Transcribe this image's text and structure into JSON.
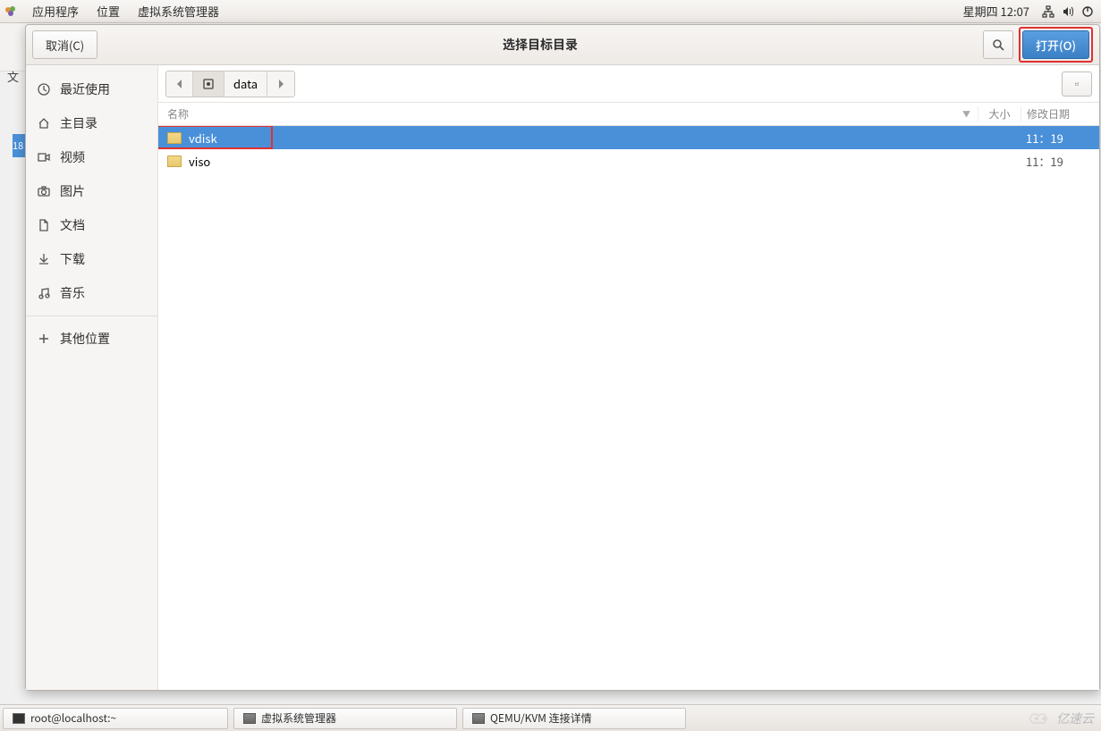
{
  "top_panel": {
    "menus": [
      "应用程序",
      "位置",
      "虚拟系统管理器"
    ],
    "clock": "星期四 12:07"
  },
  "bg": {
    "label": "文",
    "row": "18"
  },
  "dialog": {
    "cancel": "取消(C)",
    "title": "选择目标目录",
    "open": "打开(O)",
    "breadcrumb": {
      "current": "data"
    },
    "sidebar": [
      {
        "icon": "clock-icon",
        "label": "最近使用"
      },
      {
        "icon": "home-icon",
        "label": "主目录"
      },
      {
        "icon": "video-icon",
        "label": "视频"
      },
      {
        "icon": "camera-icon",
        "label": "图片"
      },
      {
        "icon": "document-icon",
        "label": "文档"
      },
      {
        "icon": "download-icon",
        "label": "下载"
      },
      {
        "icon": "music-icon",
        "label": "音乐"
      }
    ],
    "other_places": "其他位置",
    "columns": {
      "name": "名称",
      "size": "大小",
      "date": "修改日期"
    },
    "files": [
      {
        "name": "vdisk",
        "date": "11：19",
        "selected": true,
        "highlight": true
      },
      {
        "name": "viso",
        "date": "11：19",
        "selected": false,
        "highlight": false
      }
    ]
  },
  "taskbar": {
    "items": [
      {
        "icon": "terminal-icon",
        "label": "root@localhost:~"
      },
      {
        "icon": "vm-icon",
        "label": "虚拟系统管理器"
      },
      {
        "icon": "vm-icon",
        "label": "QEMU/KVM 连接详情"
      }
    ],
    "watermark": "亿速云"
  }
}
